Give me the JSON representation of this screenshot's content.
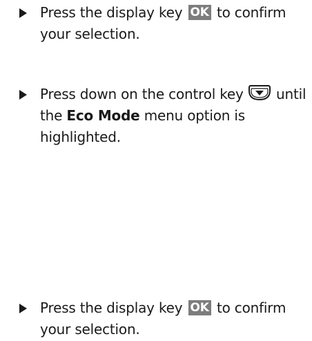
{
  "steps": [
    {
      "text_before": "Press the display key",
      "key_label": "OK",
      "text_after": "to confirm your selection."
    },
    {
      "text_before": "Press down on the control key",
      "icon": "control-key-down-icon",
      "text_mid": "until the",
      "bold_term": "Eco Mode",
      "text_after": "menu option is highlighted."
    },
    {
      "text_before": "Press the display key",
      "key_label": "OK",
      "text_after": "to confirm your selection."
    }
  ],
  "colors": {
    "text": "#1a1a1a",
    "key_background": "#7d7d7d",
    "key_text": "#ffffff"
  }
}
